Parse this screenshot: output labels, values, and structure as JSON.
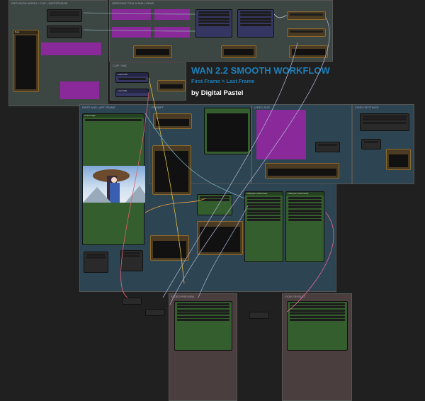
{
  "title": {
    "main": "WAN 2.2 SMOOTH WORKFLOW",
    "sub": "First Frame > Last Frame",
    "author": "by Digital Pastel"
  },
  "groups": {
    "models": "DIFFUSION MODEL / CLIP / SAFETENSOR",
    "speed": "SPEEDING TOOLS AND LORAS",
    "clipvae": "CLIP / VAE",
    "frames": "FIRST AND LAST FRAME",
    "prompt": "PROMPT",
    "size": "VIDEO SIZE",
    "settings": "VIDEO SETTINGS",
    "preview": "VIDEO PREVIEW",
    "result": "VIDEO RESULT"
  },
  "nodes": {
    "note": "Note",
    "ksampler1": "KSampler (Advanced)",
    "ksampler2": "KSampler (Advanced)",
    "load_image": "Load Image",
    "clip": "Load CLIP",
    "vae": "Load VAE"
  }
}
